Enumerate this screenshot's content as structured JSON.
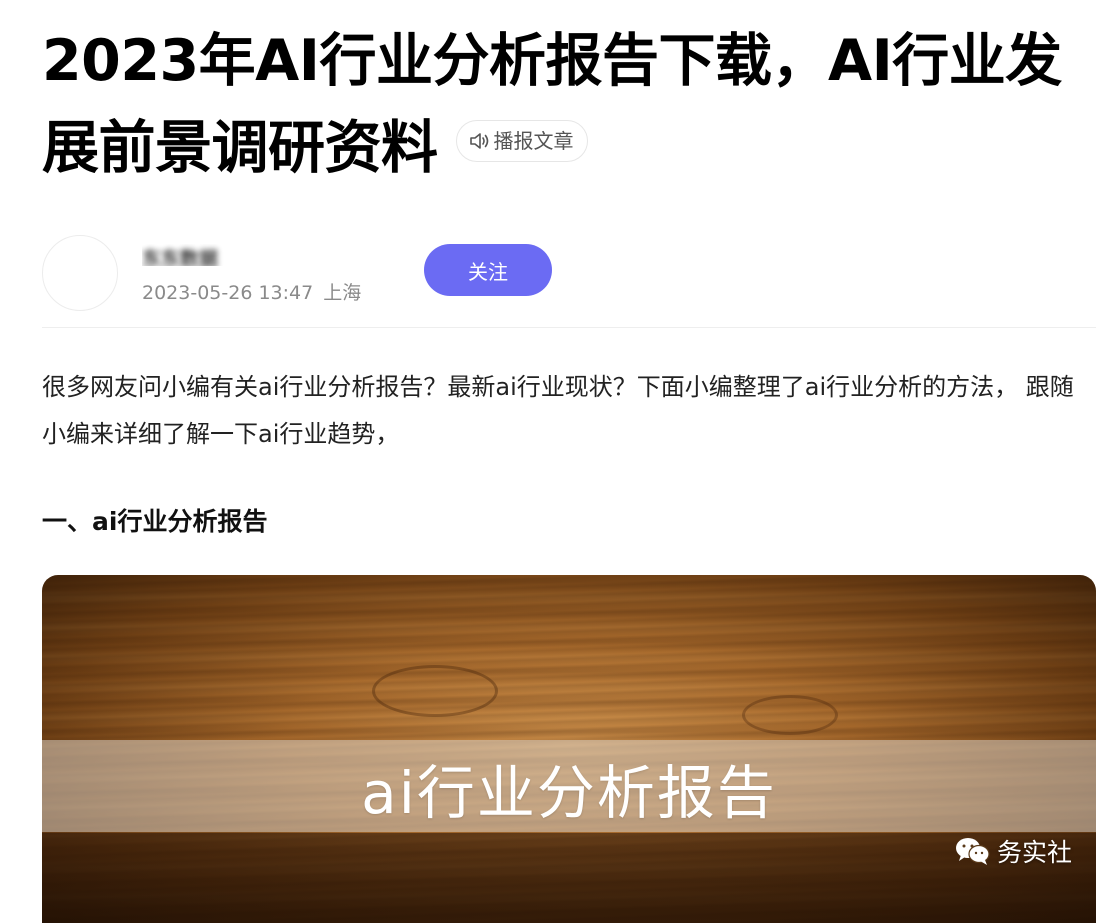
{
  "article": {
    "title": "2023年AI行业分析报告下载，AI行业发展前景调研资料",
    "listen_label": "播报文章",
    "author": {
      "name": "东东数据",
      "date": "2023-05-26 13:47",
      "location": "上海",
      "follow_label": "关注"
    },
    "intro": "很多网友问小编有关ai行业分析报告？最新ai行业现状？下面小编整理了ai行业分析的方法， 跟随小编来详细了解一下ai行业趋势，",
    "section_heading": "一、ai行业分析报告",
    "image": {
      "banner_text": "ai行业分析报告",
      "watermark": "务实社"
    }
  },
  "icons": {
    "listen": "speaker-icon",
    "watermark": "wechat-icon"
  },
  "colors": {
    "follow_button": "#6b6bf3",
    "meta_text": "#8a8a8a"
  }
}
